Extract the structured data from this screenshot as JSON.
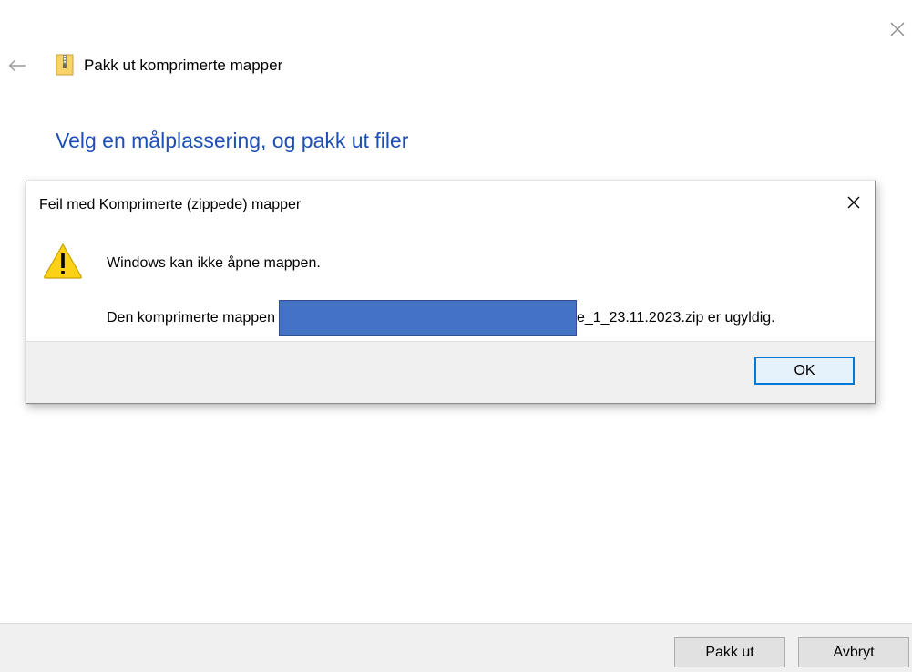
{
  "wizard": {
    "title": "Pakk ut komprimerte mapper",
    "heading": "Velg en målplassering, og pakk ut filer",
    "icons": {
      "back": "back-arrow-icon",
      "close": "close-icon",
      "zip": "zip-folder-icon"
    },
    "buttons": {
      "extract": "Pakk ut",
      "cancel": "Avbryt"
    }
  },
  "dialog": {
    "title": "Feil med Komprimerte (zippede) mapper",
    "message": "Windows kan ikke åpne mappen.",
    "detail_prefix": "Den komprimerte mappen",
    "detail_suffix": "e_1_23.11.2023.zip er ugyldig.",
    "ok_label": "OK",
    "icons": {
      "warning": "warning-icon",
      "close": "close-icon"
    },
    "colors": {
      "redaction": "#4472c4",
      "accent": "#0078d7"
    }
  },
  "colors": {
    "heading": "#1e4fb5",
    "footer_bg": "#f0f0f0"
  }
}
